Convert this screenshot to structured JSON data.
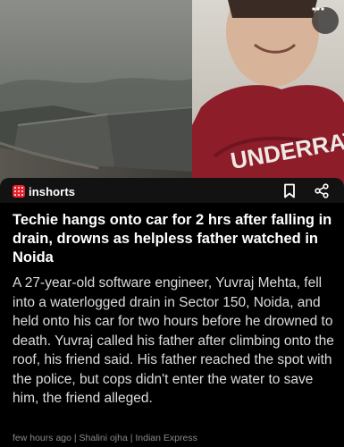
{
  "brand": {
    "name": "inshorts",
    "logo_color": "#e5202a"
  },
  "hero": {
    "description_icons": [
      "more-vertical-icon"
    ],
    "shirt_text": "UNDERRATED"
  },
  "actions": {
    "bookmark_icon": "bookmark-icon",
    "share_icon": "share-icon"
  },
  "article": {
    "title": "Techie hangs onto car for 2 hrs after falling in drain, drowns as helpless father watched in Noida",
    "body": "A 27-year-old software engineer, Yuvraj Mehta, fell into a waterlogged drain in Sector 150, Noida, and held onto his car for two hours before he drowned to death. Yuvraj called his father after climbing onto the roof, his friend said. His father reached the spot with the police, but cops didn't enter the water to save him, the friend alleged.",
    "meta": "few hours ago | Shalini ojha | Indian Express"
  }
}
